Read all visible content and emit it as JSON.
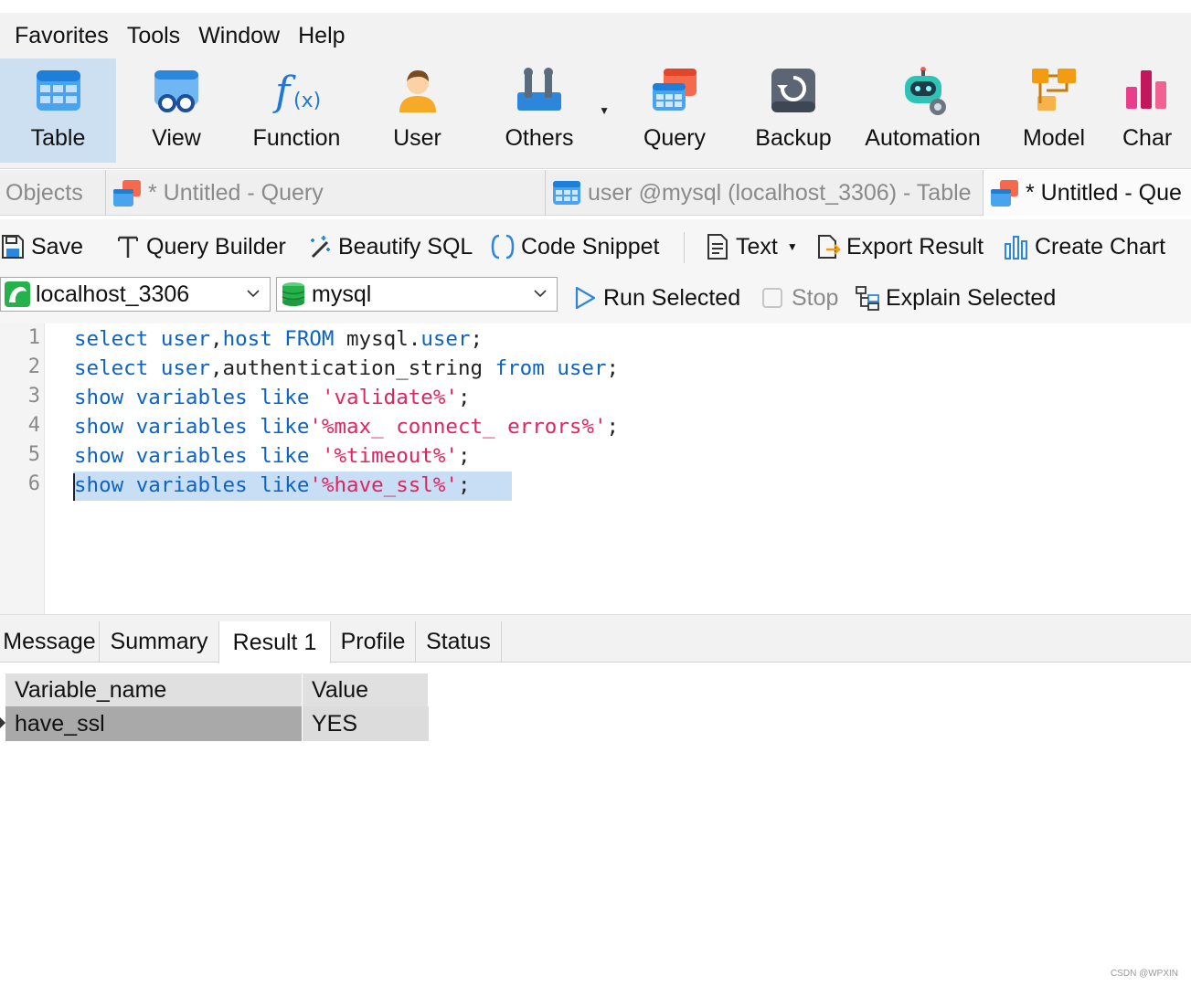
{
  "menubar": {
    "items": [
      "Favorites",
      "Tools",
      "Window",
      "Help"
    ]
  },
  "ribbon": {
    "buttons": [
      {
        "label": "Table",
        "icon": "table-icon",
        "active": true
      },
      {
        "label": "View",
        "icon": "view-icon"
      },
      {
        "label": "Function",
        "icon": "function-icon"
      },
      {
        "label": "User",
        "icon": "user-icon"
      },
      {
        "label": "Others",
        "icon": "others-icon",
        "has_dropdown": true
      },
      {
        "label": "Query",
        "icon": "query-icon"
      },
      {
        "label": "Backup",
        "icon": "backup-icon"
      },
      {
        "label": "Automation",
        "icon": "automation-icon"
      },
      {
        "label": "Model",
        "icon": "model-icon"
      },
      {
        "label": "Char",
        "icon": "chart-icon"
      }
    ]
  },
  "tabs": [
    {
      "label": "Objects",
      "active": false
    },
    {
      "label": "* Untitled - Query",
      "active": false
    },
    {
      "label": "user @mysql (localhost_3306) - Table",
      "active": false
    },
    {
      "label": "* Untitled - Que",
      "active": true
    }
  ],
  "query_toolbar": {
    "save": "Save",
    "query_builder": "Query Builder",
    "beautify_sql": "Beautify SQL",
    "code_snippet": "Code Snippet",
    "text": "Text",
    "export_result": "Export Result",
    "create_chart": "Create Chart"
  },
  "run_toolbar": {
    "connection": "localhost_3306",
    "database": "mysql",
    "run_selected": "Run Selected",
    "stop": "Stop",
    "explain_selected": "Explain Selected"
  },
  "editor": {
    "line_numbers": [
      "1",
      "2",
      "3",
      "4",
      "5",
      "6"
    ],
    "lines": [
      [
        {
          "t": "kw",
          "v": "select "
        },
        {
          "t": "kw",
          "v": "user"
        },
        {
          "t": "plain",
          "v": ","
        },
        {
          "t": "kw",
          "v": "host "
        },
        {
          "t": "kw",
          "v": "FROM "
        },
        {
          "t": "plain",
          "v": "mysql."
        },
        {
          "t": "kw",
          "v": "user"
        },
        {
          "t": "plain",
          "v": ";"
        }
      ],
      [
        {
          "t": "kw",
          "v": "select "
        },
        {
          "t": "kw",
          "v": "user"
        },
        {
          "t": "plain",
          "v": ",authentication_string "
        },
        {
          "t": "kw",
          "v": "from "
        },
        {
          "t": "kw",
          "v": "user"
        },
        {
          "t": "plain",
          "v": ";"
        }
      ],
      [
        {
          "t": "kw",
          "v": "show "
        },
        {
          "t": "kw",
          "v": "variables "
        },
        {
          "t": "kw",
          "v": "like "
        },
        {
          "t": "str",
          "v": "'validate%'"
        },
        {
          "t": "plain",
          "v": ";"
        }
      ],
      [
        {
          "t": "kw",
          "v": "show "
        },
        {
          "t": "kw",
          "v": "variables "
        },
        {
          "t": "kw",
          "v": "like"
        },
        {
          "t": "str",
          "v": "'%max_ connect_ errors%'"
        },
        {
          "t": "plain",
          "v": ";"
        }
      ],
      [
        {
          "t": "kw",
          "v": "show "
        },
        {
          "t": "kw",
          "v": "variables "
        },
        {
          "t": "kw",
          "v": "like "
        },
        {
          "t": "str",
          "v": "'%timeout%'"
        },
        {
          "t": "plain",
          "v": ";"
        }
      ],
      [
        {
          "t": "kw",
          "v": "show "
        },
        {
          "t": "kw",
          "v": "variables "
        },
        {
          "t": "kw",
          "v": "like"
        },
        {
          "t": "str",
          "v": "'%have_ssl%'"
        },
        {
          "t": "plain",
          "v": ";"
        }
      ]
    ],
    "selected_line": 6
  },
  "result_tabs": [
    {
      "label": "Message",
      "active": false
    },
    {
      "label": "Summary",
      "active": false
    },
    {
      "label": "Result 1",
      "active": true
    },
    {
      "label": "Profile",
      "active": false
    },
    {
      "label": "Status",
      "active": false
    }
  ],
  "result_grid": {
    "columns": [
      "Variable_name",
      "Value"
    ],
    "rows": [
      [
        "have_ssl",
        "YES"
      ]
    ]
  },
  "watermark": "CSDN @WPXIN",
  "colors": {
    "keyword": "#0b63c4",
    "string": "#e0245e",
    "selection": "#c7def5",
    "ribbon_active": "#cde0f2"
  }
}
